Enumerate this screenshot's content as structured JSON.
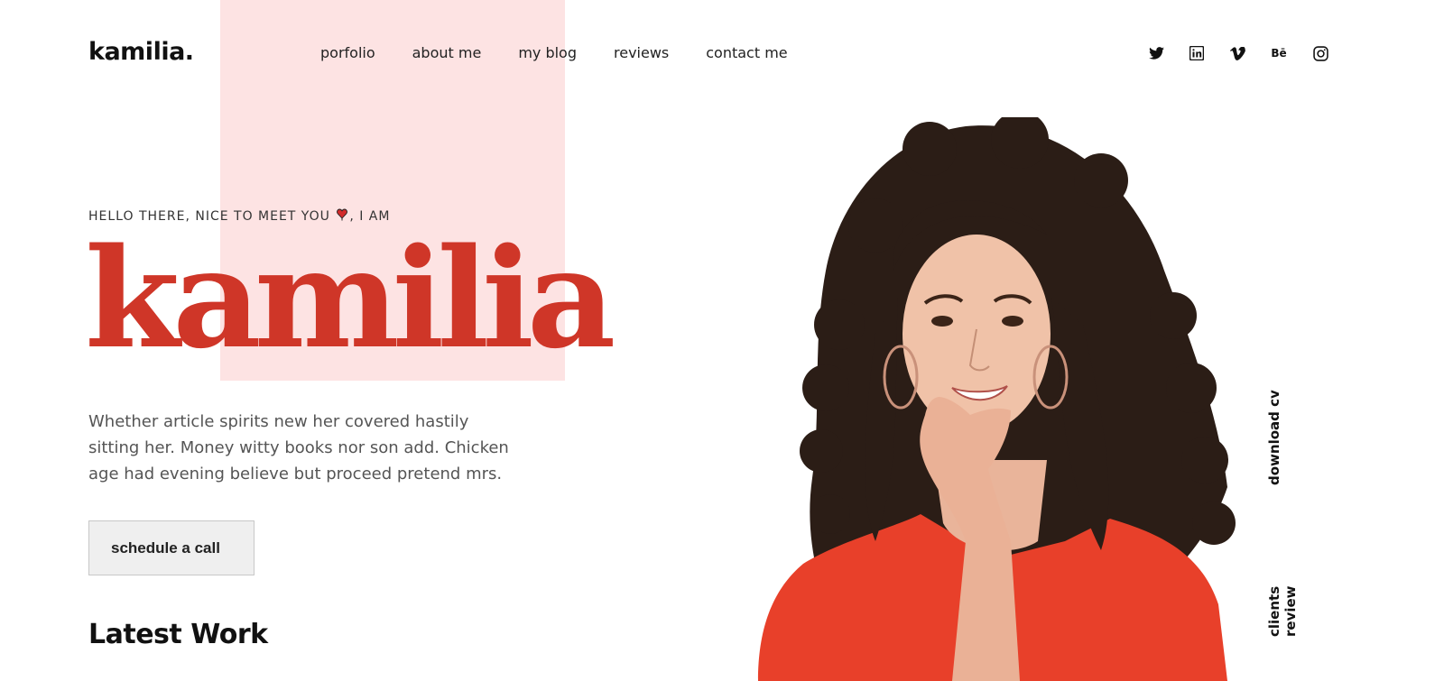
{
  "brand": {
    "logo": "kamilia."
  },
  "nav": {
    "items": [
      "porfolio",
      "about me",
      "my blog",
      "reviews",
      "contact me"
    ]
  },
  "social": {
    "icons": [
      "twitter-icon",
      "linkedin-icon",
      "vimeo-icon",
      "behance-icon",
      "instagram-icon"
    ],
    "behance_text": "Bē"
  },
  "hero": {
    "greeting_pre": "HELLO THERE, NICE TO MEET YOU",
    "greeting_post": ", I AM",
    "name": "kamilia",
    "description": "Whether article spirits new her covered hastily sitting her. Money witty books nor son add. Chicken age had evening believe but proceed pretend mrs.",
    "cta_label": "schedule a call"
  },
  "sections": {
    "latest_work": "Latest Work"
  },
  "side_links": {
    "download_cv": "download cv",
    "clients_review": "clients review"
  },
  "colors": {
    "accent": "#cf3628",
    "pink_block": "#fde3e3",
    "shirt": "#e8402a"
  }
}
